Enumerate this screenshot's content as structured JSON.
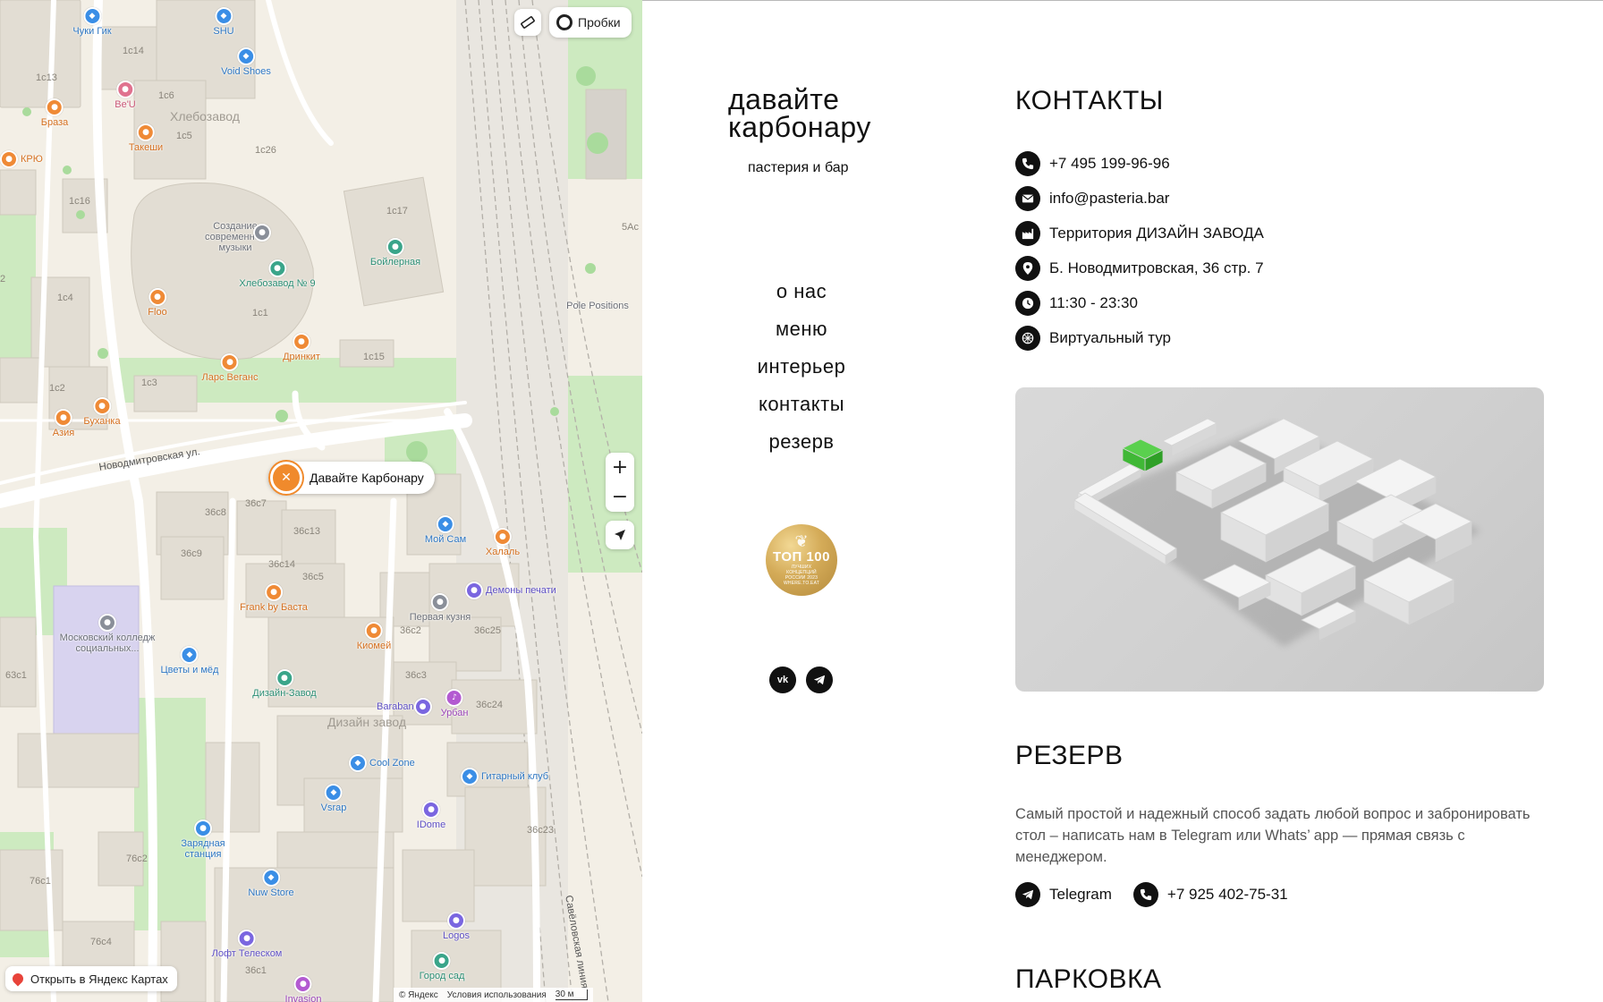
{
  "map": {
    "traffic_label": "Пробки",
    "open_in_maps": "Открыть в Яндекс Картах",
    "zoom_in": "+",
    "zoom_out": "−",
    "place_name": "Давайте Карбонару",
    "footer": {
      "brand": "© Яндекс",
      "terms": "Условия использования",
      "scale": "30 м"
    },
    "areas": [
      "Хлебозавод",
      "Дизайн завод"
    ],
    "streets": [
      "Новодмитровская ул.",
      "Савёловская линия"
    ],
    "buildings": [
      "1с14",
      "1с13",
      "1с6",
      "1с5",
      "1с26",
      "1с16",
      "1с17",
      "1с4",
      "1с1",
      "1с15",
      "1с2",
      "1с3",
      "36с8",
      "36с7",
      "36с13",
      "36с9",
      "36с14",
      "36с5",
      "36с2",
      "36с25",
      "36с3",
      "36с24",
      "36с23",
      "63с1",
      "76с2",
      "76с1",
      "76с4",
      "36с1",
      "5Ас",
      "2"
    ],
    "pois": [
      "Чуки Гик",
      "SHU",
      "Void Shoes",
      "Be'U",
      "Браза",
      "Такеши",
      "КРЮ",
      "Создание современной музыки",
      "Хлебозавод № 9",
      "Бойлерная",
      "Pole Positions",
      "Floo",
      "Дринкит",
      "Ларс Веганс",
      "Буханка",
      "Азия",
      "Мой Сам",
      "Халаль",
      "Демоны печати",
      "Frank by Баста",
      "Первая кузня",
      "Московский колледж социальных...",
      "Киомей",
      "Цветы и мёд",
      "Дизайн-Завод",
      "Baraban",
      "Урбан",
      "Cool Zone",
      "Гитарный клуб",
      "Vsrap",
      "IDome",
      "Зарядная станция",
      "Nuw Store",
      "Лофт Телеском",
      "Logos",
      "Город сад",
      "Invasion"
    ]
  },
  "brand": {
    "logo_line1": "давайте",
    "logo_line2": "карбонару",
    "tagline": "пастерия и бар"
  },
  "nav": [
    "о нас",
    "меню",
    "интерьер",
    "контакты",
    "резерв"
  ],
  "badge": {
    "title": "ТОП 100",
    "subtitle": "ЛУЧШИХ КОНЦЕПЦИЙ РОССИИ 2023 WHERE.TO.EAT"
  },
  "social": [
    "vk",
    "telegram"
  ],
  "contacts": {
    "title": "КОНТАКТЫ",
    "items": [
      {
        "icon": "phone-icon",
        "text": "+7 495 199-96-96"
      },
      {
        "icon": "mail-icon",
        "text": "info@pasteria.bar"
      },
      {
        "icon": "factory-icon",
        "text": "Территория ДИЗАЙН ЗАВОДА"
      },
      {
        "icon": "location-pin-icon",
        "text": "Б. Новодмитровская, 36 стр. 7"
      },
      {
        "icon": "clock-icon",
        "text": "11:30 - 23:30"
      },
      {
        "icon": "tour-icon",
        "text": "Виртуальный тур"
      }
    ]
  },
  "reserve": {
    "title": "РЕЗЕРВ",
    "text": "Самый простой и надежный способ задать любой вопрос и забронировать стол – написать нам в Telegram или Whats’ app — прямая связь с менеджером.",
    "telegram_label": "Telegram",
    "phone": "+7 925 402-75-31"
  },
  "parking": {
    "title": "ПАРКОВКА"
  },
  "colors": {
    "accent_green": "#3fbf3f",
    "marker_orange": "#f08a2c",
    "map_bg": "#f3efe6",
    "text": "#111111"
  }
}
